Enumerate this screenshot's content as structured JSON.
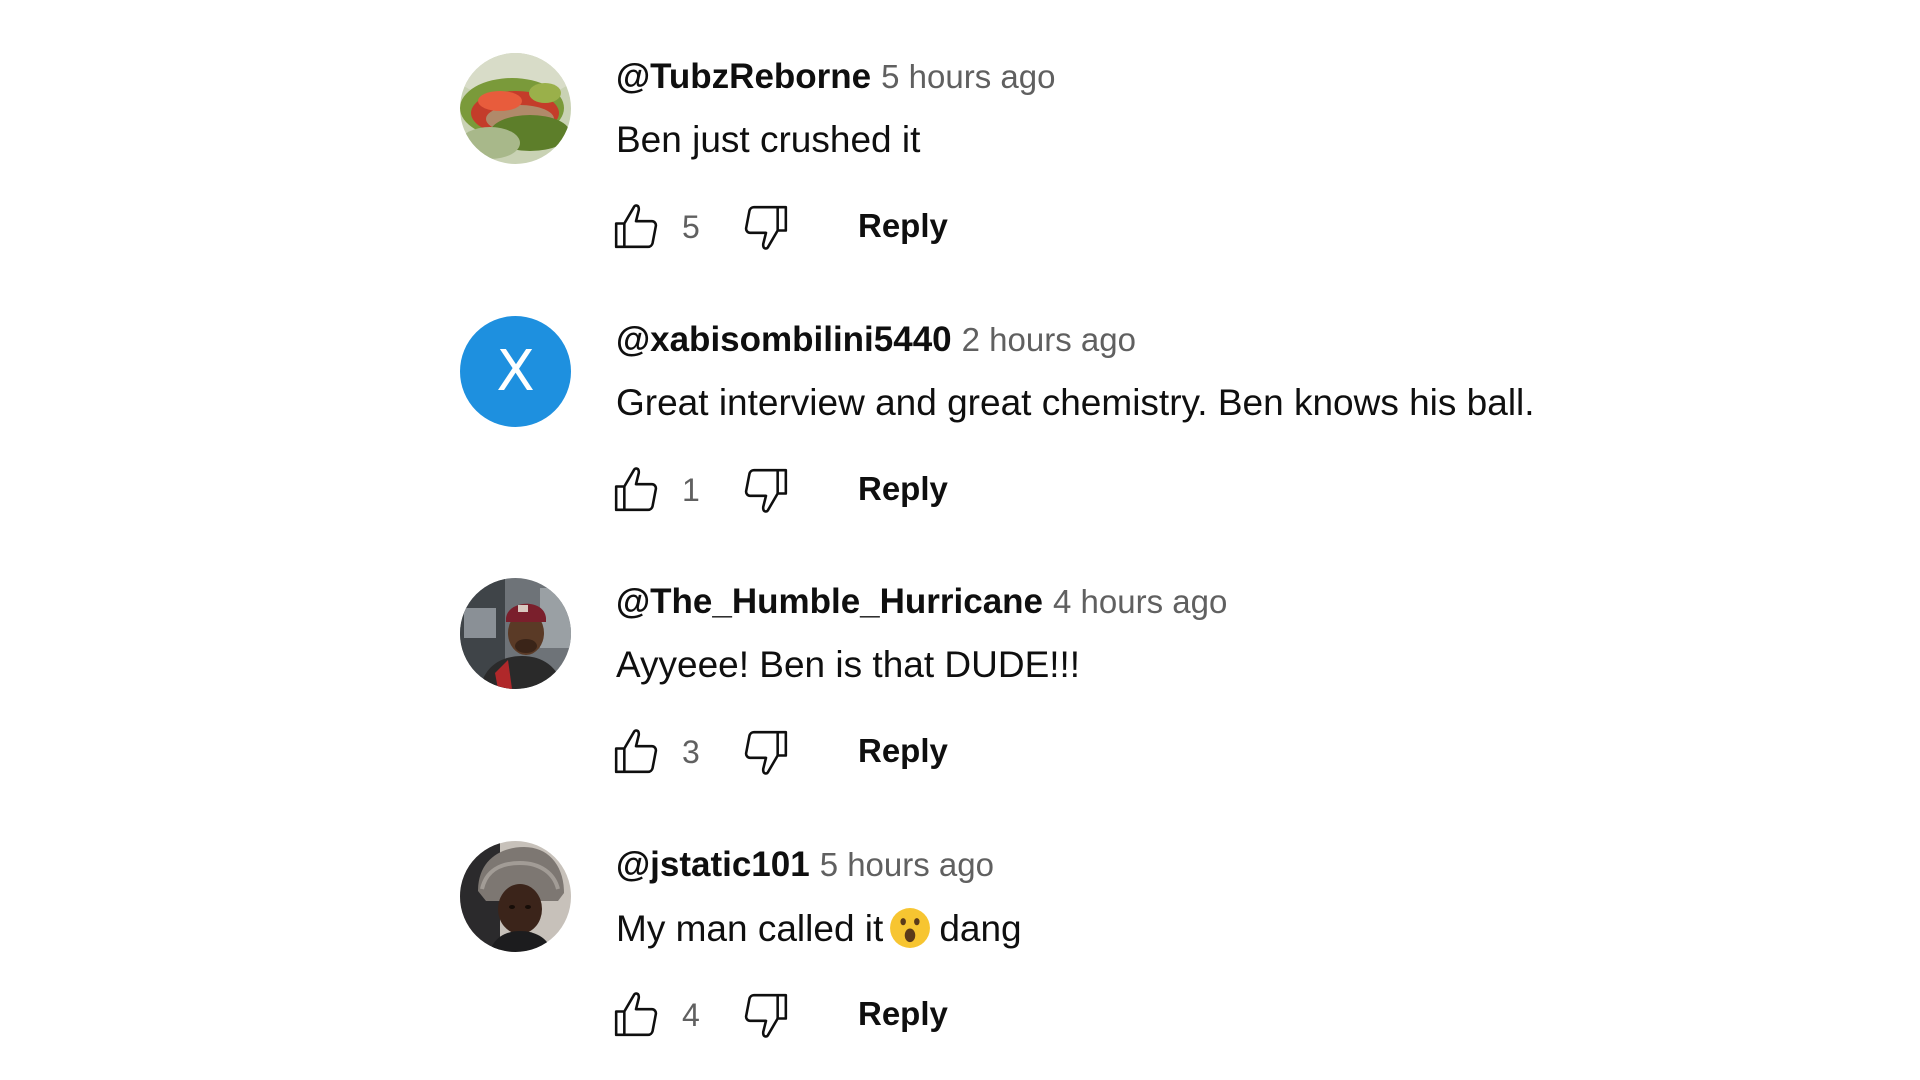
{
  "reply_label": "Reply",
  "comments": [
    {
      "author": "@TubzReborne",
      "time": "5 hours ago",
      "text": "Ben just crushed it",
      "likes": "5",
      "avatar": "food-photo"
    },
    {
      "author": "@xabisombilini5440",
      "time": "2 hours ago",
      "text": "Great interview and great chemistry. Ben knows his ball.",
      "likes": "1",
      "avatar": "letter",
      "avatar_letter": "X",
      "avatar_color": "#1e90df"
    },
    {
      "author": "@The_Humble_Hurricane",
      "time": "4 hours ago",
      "text": "Ayyeee! Ben is that DUDE!!!",
      "likes": "3",
      "avatar": "person-photo-red-cap"
    },
    {
      "author": "@jstatic101",
      "time": "5 hours ago",
      "text_before": "My man called it",
      "emoji": "astonished-face",
      "text_after": "dang",
      "likes": "4",
      "avatar": "person-photo-fur-hat"
    }
  ],
  "icons": {
    "like": "thumbs-up-icon",
    "dislike": "thumbs-down-icon"
  }
}
